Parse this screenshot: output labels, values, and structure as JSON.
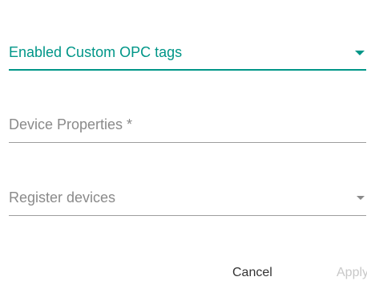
{
  "form": {
    "type_select": {
      "value": "Enabled Custom OPC tags"
    },
    "device_properties": {
      "placeholder": "Device Properties *",
      "value": ""
    },
    "register_devices": {
      "placeholder": "Register devices"
    }
  },
  "actions": {
    "cancel_label": "Cancel",
    "apply_label": "Apply"
  },
  "colors": {
    "accent": "#009688",
    "placeholder": "#8a8a8a",
    "disabled": "#c8c8c8"
  }
}
